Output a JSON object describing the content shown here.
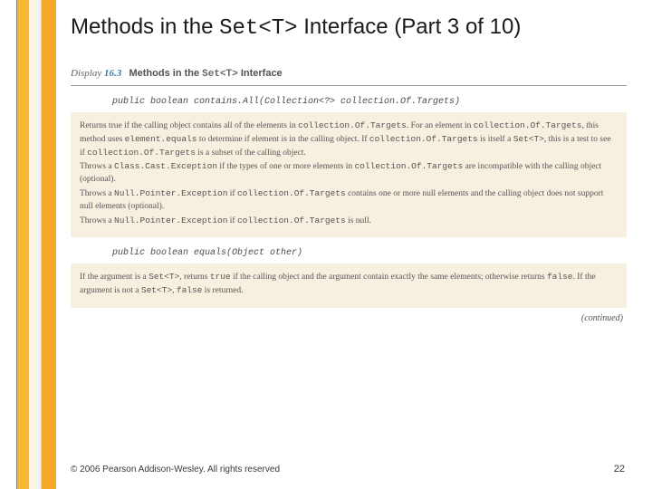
{
  "title": {
    "pre": "Methods in the ",
    "code": "Set<T>",
    "post": " Interface (Part 3 of 10)"
  },
  "display": {
    "label": "Display ",
    "num": "16.3",
    "caption_pre": "Methods in the ",
    "caption_code": "Set<T>",
    "caption_post": " Interface"
  },
  "method1": {
    "sig": "public boolean contains.All(Collection<?> collection.Of.Targets)",
    "p1a": "Returns true if the calling object contains all of the elements in ",
    "p1b": "collection.Of.Targets",
    "p1c": ". For an element in ",
    "p1d": "collection.Of.Targets",
    "p1e": ", this method uses ",
    "p1f": "element.equals",
    "p1g": " to determine if element is in the calling object. If ",
    "p1h": "collection.Of.Targets",
    "p1i": " is itself a ",
    "p1j": "Set<T>",
    "p1k": ", this is a test to see if ",
    "p1l": "collection.Of.Targets",
    "p1m": " is a subset of the calling object.",
    "p2a": "Throws a ",
    "p2b": "Class.Cast.Exception",
    "p2c": " if the types of one or more elements in ",
    "p2d": "collection.Of.Targets",
    "p2e": " are incompatible with the calling object (optional).",
    "p3a": "Throws a ",
    "p3b": "Null.Pointer.Exception",
    "p3c": " if ",
    "p3d": "collection.Of.Targets",
    "p3e": " contains one or more null elements and the calling object does not support null elements (optional).",
    "p4a": "Throws a ",
    "p4b": "Null.Pointer.Exception",
    "p4c": " if ",
    "p4d": "collection.Of.Targets",
    "p4e": " is null."
  },
  "method2": {
    "sig": "public boolean equals(Object other)",
    "p1a": "If the argument is a ",
    "p1b": "Set<T>",
    "p1c": ", returns ",
    "p1d": "true",
    "p1e": " if the calling object and the argument contain exactly the same elements; otherwise returns ",
    "p1f": "false",
    "p1g": ". If the argument is not a ",
    "p1h": "Set<T>",
    "p1i": ", ",
    "p1j": "false",
    "p1k": " is returned."
  },
  "continued": "(continued)",
  "footer": {
    "copyright": "© 2006 Pearson Addison-Wesley. All rights reserved",
    "page": "22"
  }
}
